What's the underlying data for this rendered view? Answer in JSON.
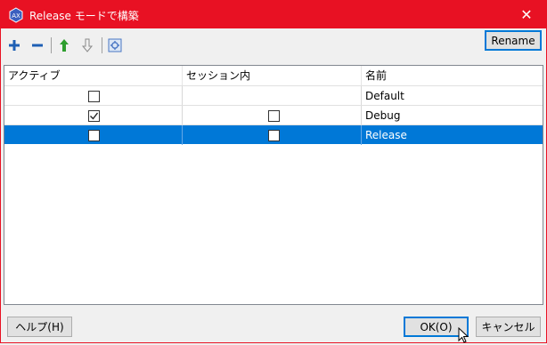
{
  "window": {
    "title": "Release モードで構築",
    "close_glyph": "✕"
  },
  "toolbar": {
    "add_icon": "plus-icon",
    "remove_icon": "minus-icon",
    "up_icon": "arrow-up-icon",
    "down_icon": "arrow-down-icon",
    "config_icon": "configuration-icon",
    "rename_label": "Rename"
  },
  "grid": {
    "columns": [
      "アクティブ",
      "セッション内",
      "名前"
    ],
    "rows": [
      {
        "active": false,
        "in_session": null,
        "name": "Default",
        "selected": false
      },
      {
        "active": true,
        "in_session": false,
        "name": "Debug",
        "selected": false
      },
      {
        "active": false,
        "in_session": false,
        "name": "Release",
        "selected": true
      }
    ]
  },
  "footer": {
    "help_label": "ヘルプ(H)",
    "ok_label": "OK(O)",
    "cancel_label": "キャンセル"
  },
  "colors": {
    "titlebar": "#e81123",
    "selection": "#0078d7",
    "add_icon": "#1e5fb4",
    "up_icon": "#2e9e2e"
  }
}
